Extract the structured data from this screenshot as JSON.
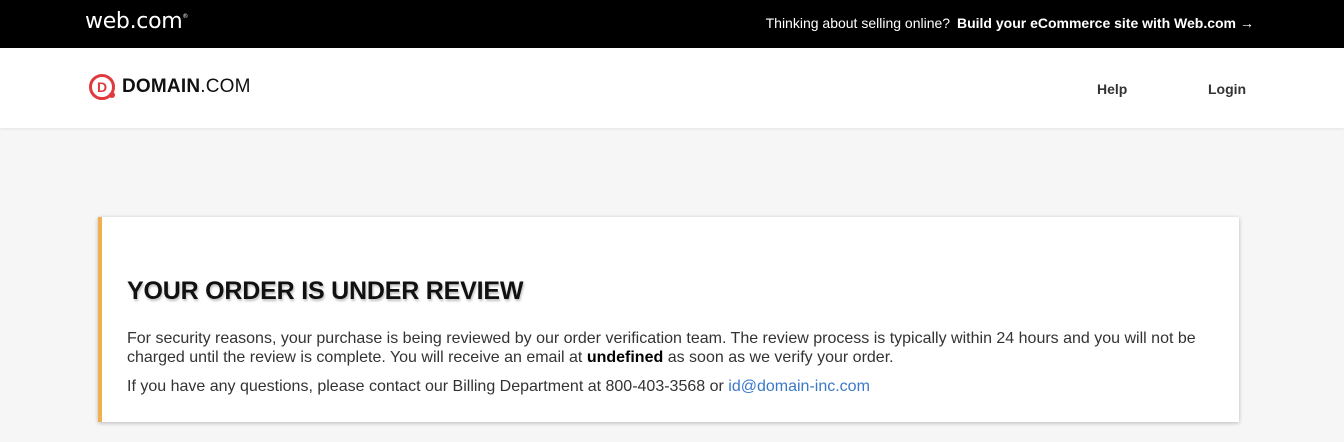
{
  "topbar": {
    "logo_text": "web.com",
    "logo_mark": "®",
    "promo_text": "Thinking about selling online?",
    "promo_link": "Build your eCommerce site with Web.com",
    "promo_arrow": "→"
  },
  "header": {
    "brand_icon_letter": "D",
    "brand_bold": "DOMAIN",
    "brand_suffix": ".COM",
    "nav": {
      "help": "Help",
      "login": "Login"
    }
  },
  "card": {
    "accent_color": "#f0b052",
    "title": "YOUR ORDER IS UNDER REVIEW",
    "para1_a": "For security reasons, your purchase is being reviewed by our order verification team. The review process is typically within 24 hours and you will not be charged until the review is complete. You will receive an email at",
    "para1_email": "undefined",
    "para1_b": "as soon as we verify your order.",
    "para2_text": "If you have any questions, please contact our Billing Department at 800-403-3568 or",
    "para2_email": "id@domain-inc.com"
  }
}
